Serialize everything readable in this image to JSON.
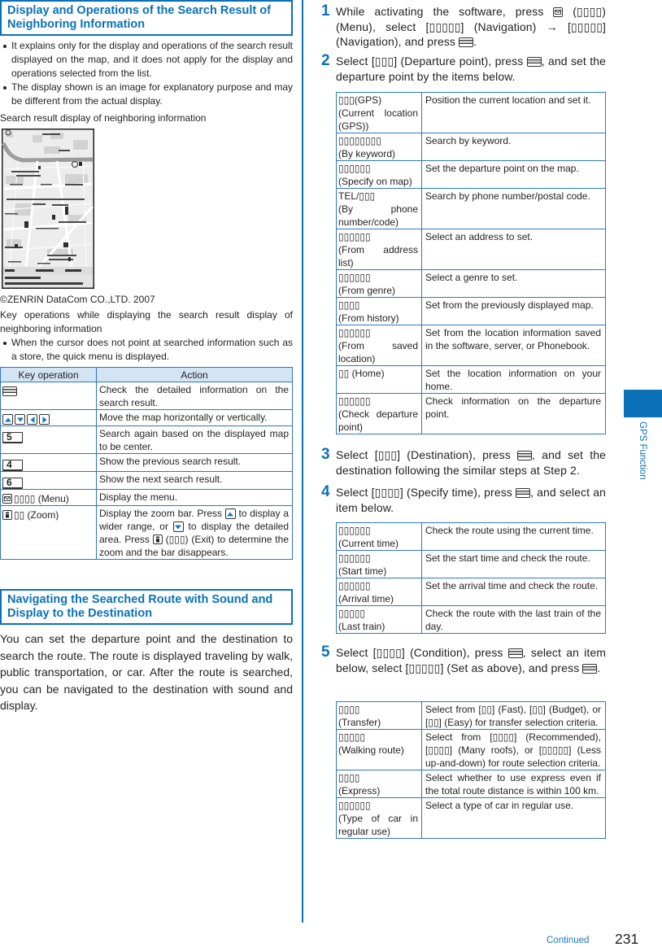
{
  "page": {
    "side_tab_label": "GPS Function",
    "continued_label": "Continued",
    "page_number": "231",
    "colors": {
      "accent": "#0a71b9",
      "table_rule": "#2f78bd",
      "table_header_bg": "#d3e4f4"
    }
  },
  "display_section": {
    "title": "Display and Operations of the Search Result of Neighboring Information",
    "bullets": [
      "It explains only for the display and operations of the search result displayed on the map, and it does not apply for the display and operations selected from the list.",
      "The display shown is an image for explanatory purpose and may be different from the actual display."
    ],
    "figure_caption": "Search result display of neighboring information",
    "figure_credit": "©ZENRIN DataCom CO.,LTD. 2007",
    "key_ops_heading": "Key operations while displaying the search result display of neighboring information",
    "key_ops_note": "When the cursor does not point at searched information such as a store, the quick menu is displayed.",
    "key_table": {
      "headers": {
        "key": "Key operation",
        "action": "Action"
      },
      "rows": [
        {
          "key_icons": [
            "menu-key-icon"
          ],
          "action": "Check the detailed information on the search result."
        },
        {
          "key_icons": [
            "up-key-icon",
            "down-key-icon",
            "left-key-icon",
            "right-key-icon"
          ],
          "action": "Move the map horizontally or vertically."
        },
        {
          "key_icons": [
            "number-key-icon"
          ],
          "key_digit": "5",
          "action": "Search again based on the displayed map to be center."
        },
        {
          "key_icons": [
            "number-key-icon"
          ],
          "key_digit": "4",
          "action": "Show the previous search result."
        },
        {
          "key_icons": [
            "number-key-icon"
          ],
          "key_digit": "6",
          "action": "Show the next search result."
        },
        {
          "key_icons": [
            "mail-key-icon"
          ],
          "key_label": "▯▯▯▯ (Menu)",
          "action": "Display the menu."
        },
        {
          "key_icons": [
            "i-key-icon"
          ],
          "key_label": "▯▯ (Zoom)",
          "action_parts": [
            "Display the zoom bar. Press ",
            " to display a wider range, or ",
            " to display the detailed area. Press ",
            " (▯▯▯) (Exit) to determine the zoom and the bar disappears."
          ],
          "action_icons": [
            "up-key-icon",
            "down-key-icon",
            "i-key-icon"
          ]
        }
      ]
    }
  },
  "navigation_section": {
    "title": "Navigating the Searched Route with Sound and Display to the Destination",
    "intro": "You can set the departure point and the destination to search the route. The route is displayed traveling by walk, public transportation, or car. After the route is searched, you can be navigated to the destination with sound and display.",
    "steps": [
      {
        "number": "1",
        "parts": [
          "While activating the software, press ",
          " (▯▯▯▯) (Menu), select [▯▯▯▯▯] (Navigation) → [▯▯▯▯▯] (Navigation), and press ",
          "."
        ],
        "icons": [
          "mail-key-icon",
          "menu-key-icon"
        ]
      },
      {
        "number": "2",
        "parts": [
          "Select [▯▯▯] (Departure point), press ",
          ", and set the departure point by the items below."
        ],
        "icons": [
          "menu-key-icon"
        ]
      },
      {
        "number": "3",
        "parts": [
          "Select [▯▯▯] (Destination), press ",
          ", and set the destination following the similar steps at Step 2."
        ],
        "icons": [
          "menu-key-icon"
        ]
      },
      {
        "number": "4",
        "parts": [
          "Select [▯▯▯▯] (Specify time), press ",
          ", and select an item below."
        ],
        "icons": [
          "menu-key-icon"
        ]
      },
      {
        "number": "5",
        "parts": [
          "Select [▯▯▯▯] (Condition), press ",
          ", select an item below, select [▯▯▯▯▯] (Set as above), and press ",
          "."
        ],
        "icons": [
          "menu-key-icon",
          "menu-key-icon"
        ]
      }
    ],
    "departure_table": {
      "rows": [
        {
          "jp": "▯▯▯(GPS)",
          "en": "(Current location (GPS))",
          "desc": "Position the current location and set it."
        },
        {
          "jp": "▯▯▯▯▯▯▯▯",
          "en": "(By keyword)",
          "desc": "Search by keyword."
        },
        {
          "jp": "▯▯▯▯▯▯",
          "en": "(Specify on map)",
          "desc": "Set the departure point on the map."
        },
        {
          "jp": "TEL/▯▯▯",
          "en": "(By phone number/code)",
          "desc": "Search by phone number/postal code."
        },
        {
          "jp": "▯▯▯▯▯▯",
          "en": "(From address list)",
          "desc": "Select an address to set."
        },
        {
          "jp": "▯▯▯▯▯▯",
          "en": "(From genre)",
          "desc": "Select a genre to set."
        },
        {
          "jp": "▯▯▯▯",
          "en": "(From history)",
          "desc": "Set from the previously displayed map."
        },
        {
          "jp": "▯▯▯▯▯▯",
          "en": "(From saved location)",
          "desc": "Set from the location information saved in the software, server, or Phonebook."
        },
        {
          "jp": "▯▯",
          "en": "(Home)",
          "desc": "Set the location information on your home."
        },
        {
          "jp": "▯▯▯▯▯▯",
          "en": "(Check departure point)",
          "desc": "Check information on the departure point."
        }
      ]
    },
    "time_table": {
      "rows": [
        {
          "jp": "▯▯▯▯▯▯",
          "en": "(Current time)",
          "desc": "Check the route using the current time."
        },
        {
          "jp": "▯▯▯▯▯▯",
          "en": "(Start time)",
          "desc": "Set the start time and check the route."
        },
        {
          "jp": "▯▯▯▯▯▯",
          "en": "(Arrival time)",
          "desc": "Set the arrival time and check the route."
        },
        {
          "jp": "▯▯▯▯▯",
          "en": "(Last train)",
          "desc": "Check the route with the last train of the day."
        }
      ]
    },
    "condition_table": {
      "rows": [
        {
          "jp": "▯▯▯▯",
          "en": "(Transfer)",
          "desc": "Select from [▯▯] (Fast), [▯▯] (Budget), or [▯▯] (Easy) for transfer selection criteria."
        },
        {
          "jp": "▯▯▯▯▯",
          "en": "(Walking route)",
          "desc": "Select from [▯▯▯▯] (Recommended), [▯▯▯▯] (Many roofs), or [▯▯▯▯▯] (Less up-and-down) for route selection criteria."
        },
        {
          "jp": "▯▯▯▯",
          "en": "(Express)",
          "desc": "Select whether to use express even if the total route distance is within 100 km."
        },
        {
          "jp": "▯▯▯▯▯▯",
          "en": "(Type of car in regular use)",
          "desc": "Select a type of car in regular use."
        }
      ]
    }
  }
}
